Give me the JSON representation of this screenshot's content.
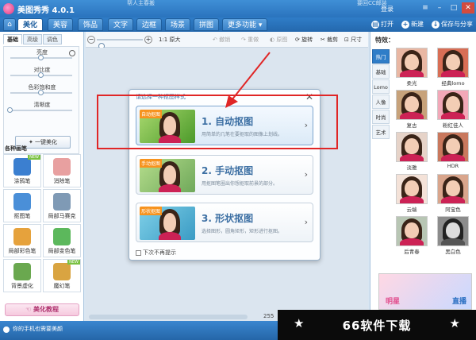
{
  "title_bar": {
    "app_title": "美图秀秀 4.0.1",
    "hint_left": "帮人主春搬",
    "hint_right": "要回CC邮装",
    "login": "登录"
  },
  "menu": {
    "tabs": [
      "美化",
      "美容",
      "饰品",
      "文字",
      "边框",
      "场景",
      "拼图",
      "更多功能 ▾"
    ],
    "active_index": 0,
    "actions": [
      {
        "icon": "open-icon",
        "label": "打开"
      },
      {
        "icon": "new-icon",
        "label": "新建"
      },
      {
        "icon": "save-icon",
        "label": "保存与分享"
      }
    ]
  },
  "left_panel": {
    "sub_tabs": [
      "基础",
      "高级",
      "调色"
    ],
    "active_sub_tab": 0,
    "sliders": [
      {
        "label": "亮度",
        "value": 0.5
      },
      {
        "label": "对比度",
        "value": 0.5
      },
      {
        "label": "色彩饱和度",
        "value": 0.5
      },
      {
        "label": "清晰度",
        "value": 0.0
      }
    ],
    "one_key_button": "一键美化",
    "brushes_title": "各种画笔",
    "brushes": [
      {
        "label": "涂鸦笔",
        "icon": "doodle-brush-icon",
        "color": "#3b7fd0",
        "is_new": true,
        "new_tag": "NEW"
      },
      {
        "label": "消除笔",
        "icon": "eraser-brush-icon",
        "color": "#e8a0a0",
        "is_new": false
      },
      {
        "label": "抠图笔",
        "icon": "cutout-brush-icon",
        "color": "#4a8fd8",
        "is_new": false
      },
      {
        "label": "局部马赛克",
        "icon": "mosaic-brush-icon",
        "color": "#7f9ab5",
        "is_new": false
      },
      {
        "label": "局部彩色笔",
        "icon": "color-brush-icon",
        "color": "#e6a23c",
        "is_new": false
      },
      {
        "label": "局部变色笔",
        "icon": "recolor-brush-icon",
        "color": "#5cb85c",
        "is_new": false
      },
      {
        "label": "背景虚化",
        "icon": "blur-background-icon",
        "color": "#6aa84f",
        "is_new": false
      },
      {
        "label": "魔幻笔",
        "icon": "magic-brush-icon",
        "color": "#d9a441",
        "is_new": true,
        "new_tag": "NEW"
      }
    ],
    "tutorial_button": "美化教程"
  },
  "toolbar": {
    "zoom_level": 0.0,
    "original_size": "1:1 原大",
    "undo": "撤销",
    "redo": "重做",
    "original": "原图",
    "rotate": "旋转",
    "crop": "裁剪",
    "resize": "尺寸"
  },
  "canvas": {
    "zoom_text": "255"
  },
  "dialog": {
    "title": "请选择一种抠图样式",
    "options": [
      {
        "tag": "自动抠图",
        "title": "1. 自动抠图",
        "desc": "用简单的几笔在要抠取的图像上划线。",
        "selected": true
      },
      {
        "tag": "手动抠图",
        "title": "2. 手动抠图",
        "desc": "用抠图笔圈出你想抠取前景的部分。",
        "selected": false
      },
      {
        "tag": "形状抠图",
        "title": "3. 形状抠图",
        "desc": "选择图形，圆角矩形，矩形进行抠图。",
        "selected": false
      }
    ],
    "dont_show": "下次不再提示"
  },
  "right_panel": {
    "title": "特效：",
    "categories": [
      "热门",
      "基础",
      "Lomo",
      "人像",
      "时尚",
      "艺术"
    ],
    "active_category": 0,
    "effects": [
      {
        "label": "柔光",
        "tone": "#e9b7a3"
      },
      {
        "label": "经典lomo",
        "tone": "#d86e55"
      },
      {
        "label": "复古",
        "tone": "#c7a27a"
      },
      {
        "label": "粉红佳人",
        "tone": "#f2a8b8"
      },
      {
        "label": "淡雅",
        "tone": "#e6d3c8"
      },
      {
        "label": "HDR",
        "tone": "#c9785d"
      },
      {
        "label": "云端",
        "tone": "#f4e2d8"
      },
      {
        "label": "阿宝色",
        "tone": "#d9a58c"
      },
      {
        "label": "后青春",
        "tone": "#b8c6b4"
      },
      {
        "label": "黑白色",
        "tone": "#8c8c8c"
      }
    ],
    "ad_text_1": "明星",
    "ad_text_2": "直播"
  },
  "status_bar": {
    "text": "你的手机也需要美颜"
  },
  "watermark": {
    "text": "66软件下载",
    "star": "★"
  }
}
